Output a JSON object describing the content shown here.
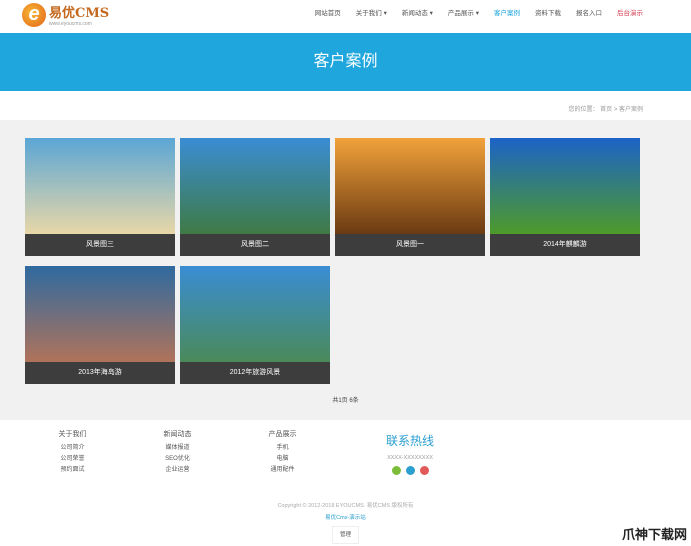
{
  "header": {
    "logo_name": "易优CMS",
    "logo_url": "www.eyoucms.com",
    "nav": [
      "网站首页",
      "关于我们 ▾",
      "新闻动态 ▾",
      "产品展示 ▾",
      "客户案例",
      "资料下载",
      "报名入口",
      "后台演示"
    ]
  },
  "banner": {
    "title": "客户案例"
  },
  "breadcrumb": "您的位置： 首页 > 客户案例",
  "cases": [
    {
      "caption": "风景图三",
      "colors": [
        "#5aa6d6",
        "#e8d7a7"
      ]
    },
    {
      "caption": "风景图二",
      "colors": [
        "#3a8dd4",
        "#3f7a45"
      ]
    },
    {
      "caption": "风景图一",
      "colors": [
        "#f2a23a",
        "#6b3a12"
      ]
    },
    {
      "caption": "2014年麒麟游",
      "colors": [
        "#1c63c7",
        "#4e9a2a"
      ]
    },
    {
      "caption": "2013年海岛游",
      "colors": [
        "#2e6aa0",
        "#b0735a"
      ]
    },
    {
      "caption": "2012年旅游风景",
      "colors": [
        "#3a8dd4",
        "#4a8a5a"
      ]
    }
  ],
  "pager": "共1页 6条",
  "footer": {
    "cols": [
      {
        "title": "关于我们",
        "items": [
          "公司简介",
          "公司荣誉",
          "预约面试"
        ]
      },
      {
        "title": "新闻动态",
        "items": [
          "媒体报道",
          "SEO优化",
          "企业运营"
        ]
      },
      {
        "title": "产品展示",
        "items": [
          "手机",
          "电脑",
          "通用配件"
        ]
      }
    ],
    "hotline_title": "联系热线",
    "hotline": "XXXX-XXXXXXXX",
    "copyright": "Copyright © 2012-2018 EYOUCMS. 易优CMS 版权所有",
    "site_link": "易优Cms-演示站",
    "manage": "管理"
  },
  "watermark": "爪神下载网"
}
